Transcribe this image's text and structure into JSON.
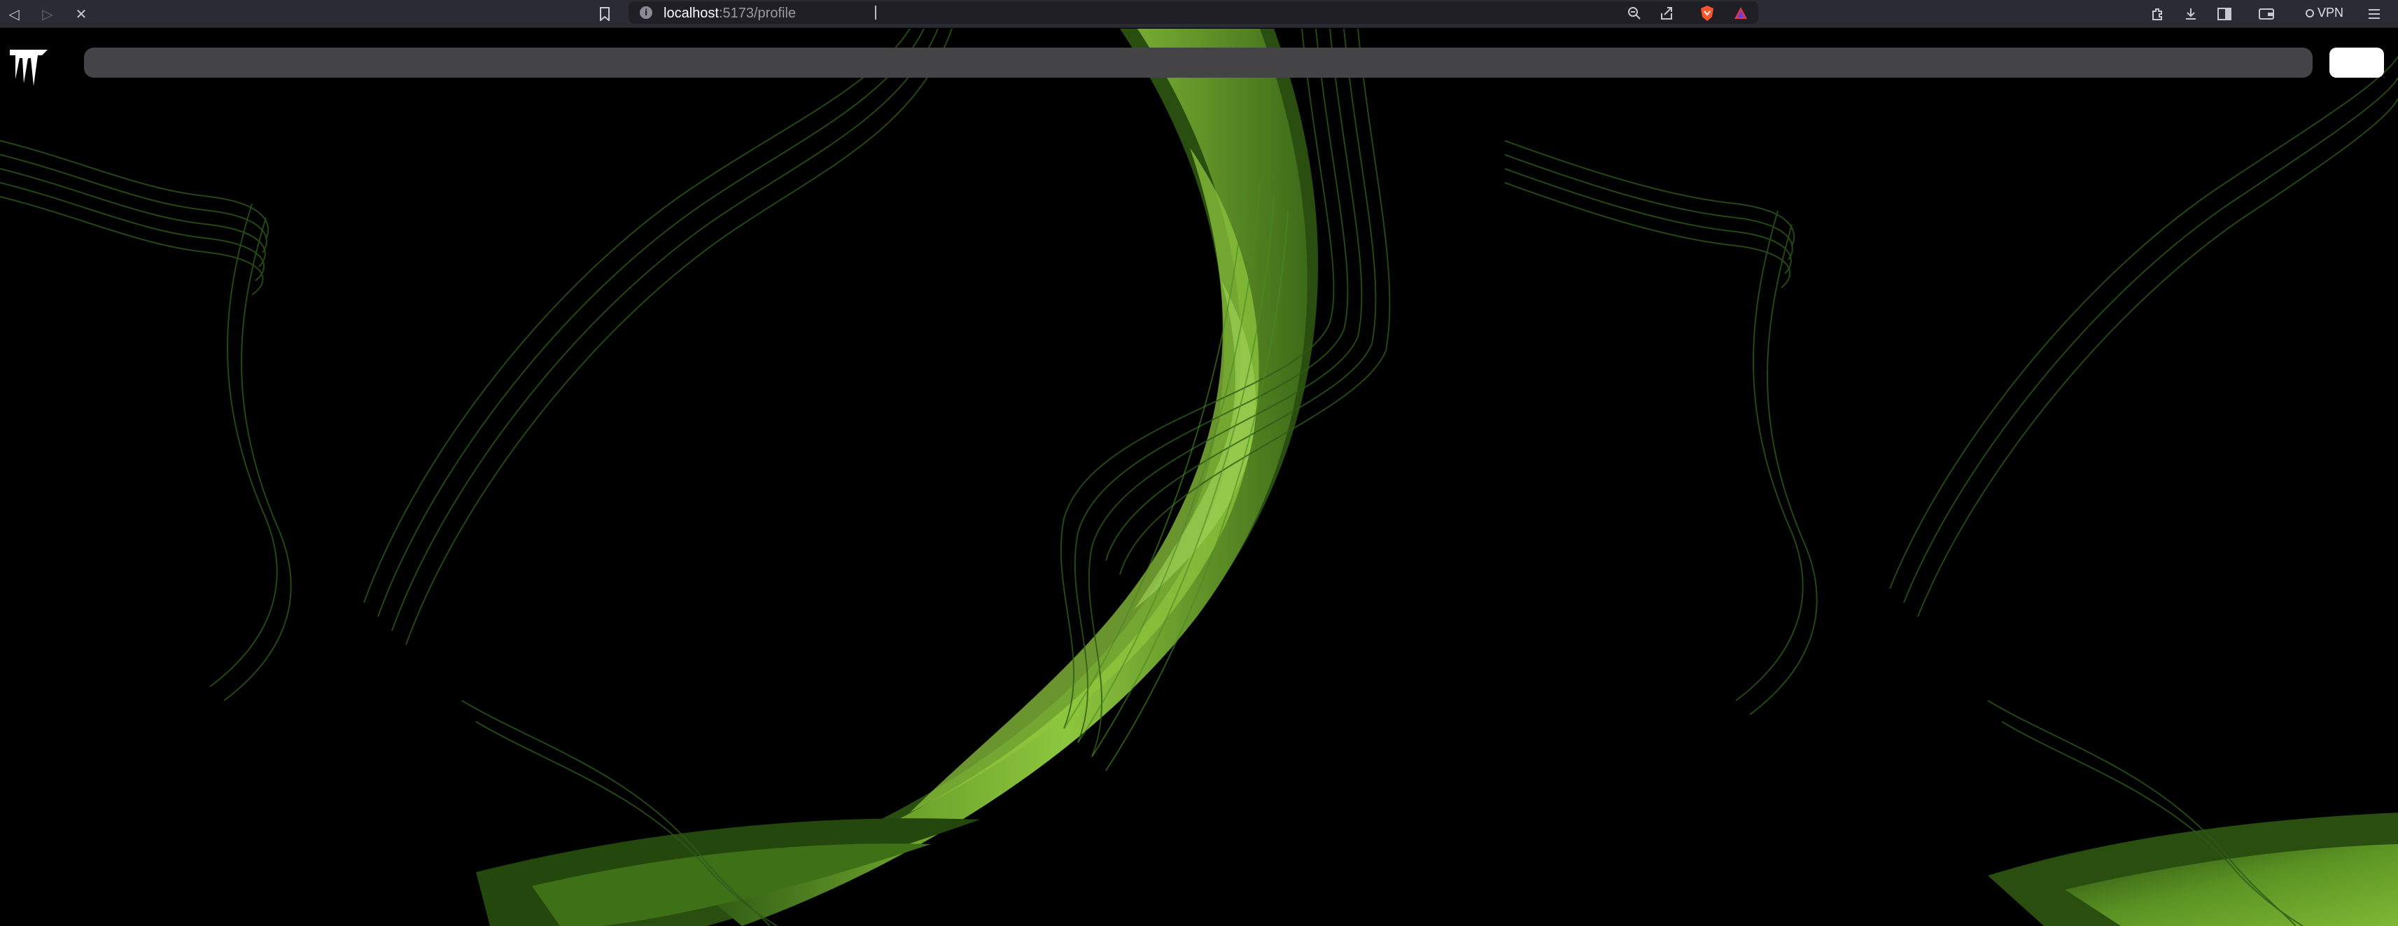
{
  "browser": {
    "url_host": "localhost",
    "url_path": ":5173/profile",
    "vpn_label": "VPN",
    "icons": [
      "back-icon",
      "forward-icon",
      "stop-icon",
      "bookmark-icon",
      "site-info-icon",
      "zoom-icon",
      "share-icon",
      "brave-shields-icon",
      "brave-rewards-icon",
      "extensions-icon",
      "downloads-icon",
      "sidebar-icon",
      "wallet-icon",
      "menu-icon"
    ]
  },
  "header": {
    "logo": "site-logo",
    "search_placeholder": "",
    "button_label": ""
  },
  "colors": {
    "page_background": "#000000",
    "accent_green": "#8cc63f",
    "search_bar": "#444446",
    "chrome": "#2b2b33"
  }
}
